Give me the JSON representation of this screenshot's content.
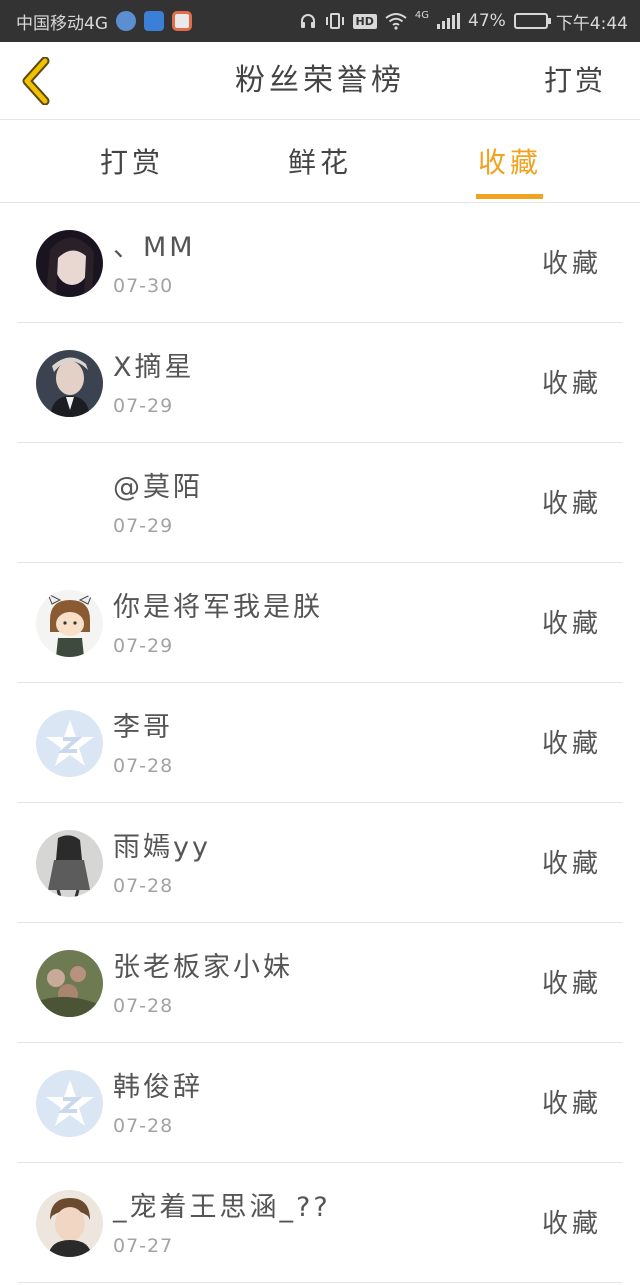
{
  "status_bar": {
    "carrier": "中国移动4G",
    "network": "4G",
    "battery": "47%",
    "battery_level": 0.47,
    "time": "下午4:44",
    "icons": [
      "headphones-icon",
      "vibrate-icon",
      "hd-icon",
      "wifi-icon",
      "signal-icon",
      "battery-icon"
    ]
  },
  "header": {
    "title": "粉丝荣誉榜",
    "action_label": "打赏",
    "back_icon": "chevron-left-icon"
  },
  "tabs": [
    {
      "label": "打赏",
      "active": false
    },
    {
      "label": "鲜花",
      "active": false
    },
    {
      "label": "收藏",
      "active": true
    }
  ],
  "colors": {
    "accent": "#f0a321",
    "back_arrow": "#f2c200"
  },
  "fans": [
    {
      "name": "、MM",
      "date": "07-30",
      "action": "收藏",
      "avatar": "photo"
    },
    {
      "name": "X摘星",
      "date": "07-29",
      "action": "收藏",
      "avatar": "photo"
    },
    {
      "name": "@莫陌",
      "date": "07-29",
      "action": "收藏",
      "avatar": "none"
    },
    {
      "name": "你是将军我是朕",
      "date": "07-29",
      "action": "收藏",
      "avatar": "cartoon"
    },
    {
      "name": "李哥",
      "date": "07-28",
      "action": "收藏",
      "avatar": "qq-default"
    },
    {
      "name": "雨嫣yy",
      "date": "07-28",
      "action": "收藏",
      "avatar": "photo"
    },
    {
      "name": "张老板家小妹",
      "date": "07-28",
      "action": "收藏",
      "avatar": "photo"
    },
    {
      "name": "韩俊辞",
      "date": "07-28",
      "action": "收藏",
      "avatar": "qq-default"
    },
    {
      "name": "_宠着王思涵_??",
      "date": "07-27",
      "action": "收藏",
      "avatar": "photo"
    }
  ]
}
